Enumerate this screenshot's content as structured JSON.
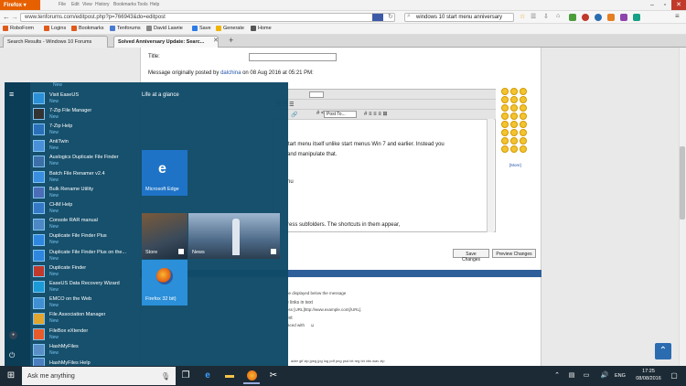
{
  "browser": {
    "menu_label": "Firefox",
    "menus": [
      "File",
      "Edit",
      "View",
      "History",
      "Bookmarks",
      "Tools",
      "Help"
    ],
    "url": "www.tenforums.com/editpost.php?p=766943&do=editpost",
    "search_value": "windows 10 start menu anniversary",
    "bookmarks": [
      "RoboForm",
      "Logins",
      "Bookmarks",
      "Tenforums",
      "David Lawrie",
      "Save",
      "Generate",
      "Home"
    ],
    "tabs": [
      "Search Results - Windows 10 Forums",
      "Solved Anniversary Update: Searc..."
    ],
    "new_tab": "+"
  },
  "page": {
    "title_label": "Title:",
    "original_message_prefix": "Message originally posted by",
    "original_author": "dalchina",
    "original_date": "on 08 Aug 2016 at 05:21 PM:",
    "font_select": "Font",
    "size_select": "Size",
    "post_to": "Post To...",
    "editor_lines": [
      "start menu itself unlike start menus Win 7 and earlier. Instead you",
      "and manipulate that.",
      "nu",
      "ress subfolders. The shortcuts in them appear,"
    ],
    "save_changes": "Save Changes",
    "preview_changes": "Preview Changes",
    "more_smilies": "[More]",
    "options": [
      "be displayed below the message",
      "e links in text",
      "ess [URL]http://www.example.com[/URL].",
      "ext",
      "laced with",
      "ader gif zip jpeg jpg log pdf png psd txt reg txt vbs wav zip"
    ]
  },
  "start_menu": {
    "top_new": "New",
    "items": [
      {
        "name": "Visit EaseUS",
        "badge": "New"
      },
      {
        "name": "7-Zip File Manager",
        "badge": "New"
      },
      {
        "name": "7-Zip Help",
        "badge": "New"
      },
      {
        "name": "AntiTwin",
        "badge": "New"
      },
      {
        "name": "Auslogics Duplicate File Finder",
        "badge": "New"
      },
      {
        "name": "Batch File Renamer v2.4",
        "badge": "New"
      },
      {
        "name": "Bulk Rename Utility",
        "badge": "New"
      },
      {
        "name": "CHM Help",
        "badge": "New"
      },
      {
        "name": "Console RAR manual",
        "badge": "New"
      },
      {
        "name": "Duplicate File Finder Plus",
        "badge": "New"
      },
      {
        "name": "Duplicate File Finder Plus on the...",
        "badge": "New"
      },
      {
        "name": "Duplicate Finder",
        "badge": "New"
      },
      {
        "name": "EaseUS Data Recovery Wizard",
        "badge": "New"
      },
      {
        "name": "EMCO on the Web",
        "badge": "New"
      },
      {
        "name": "File Association Manager",
        "badge": "New"
      },
      {
        "name": "FileBox eXtender",
        "badge": "New"
      },
      {
        "name": "HashMyFiles",
        "badge": "New"
      },
      {
        "name": "HashMyFiles Help",
        "badge": ""
      }
    ],
    "tiles_heading": "Life at a glance",
    "tiles": {
      "edge": "Microsoft Edge",
      "store": "Store",
      "news": "News",
      "firefox": "Firefox 32 bit)"
    }
  },
  "taskbar": {
    "search_placeholder": "Ask me anything",
    "language": "ENG",
    "time": "17:25",
    "date": "08/08/2016"
  },
  "colors": {
    "firefox_orange": "#e66000",
    "start_bg": "#0f4a67",
    "tile_blue": "#1e73c6",
    "taskbar_bg": "#1c2a35"
  }
}
